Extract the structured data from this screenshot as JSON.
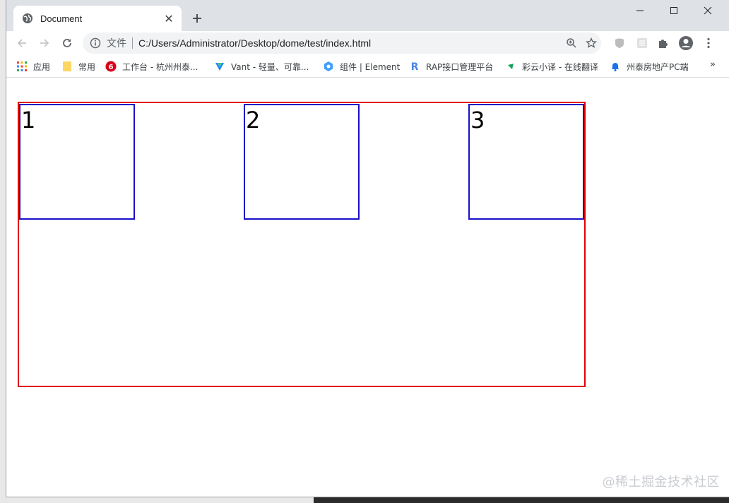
{
  "tab": {
    "title": "Document"
  },
  "omnibox": {
    "scheme_label": "文件",
    "url": "C:/Users/Administrator/Desktop/dome/test/index.html"
  },
  "bookmarks": [
    {
      "label": "应用",
      "icon": "apps-grid-icon"
    },
    {
      "label": "常用",
      "icon": "folder-icon"
    },
    {
      "label": "工作台 - 杭州州泰...",
      "icon": "site-favicon-red"
    },
    {
      "label": "Vant - 轻量、可靠...",
      "icon": "vant-icon"
    },
    {
      "label": "组件 | Element",
      "icon": "element-icon"
    },
    {
      "label": "RAP接口管理平台",
      "icon": "rap-icon"
    },
    {
      "label": "彩云小译 - 在线翻译",
      "icon": "caiyun-icon"
    },
    {
      "label": "州泰房地产PC端",
      "icon": "bell-icon"
    }
  ],
  "bookmarks_more": "»",
  "page": {
    "boxes": [
      {
        "label": "1"
      },
      {
        "label": "2"
      },
      {
        "label": "3"
      }
    ],
    "container_border_color": "#e00000",
    "box_border_color": "#1a10c8"
  },
  "watermark": "@稀土掘金技术社区"
}
